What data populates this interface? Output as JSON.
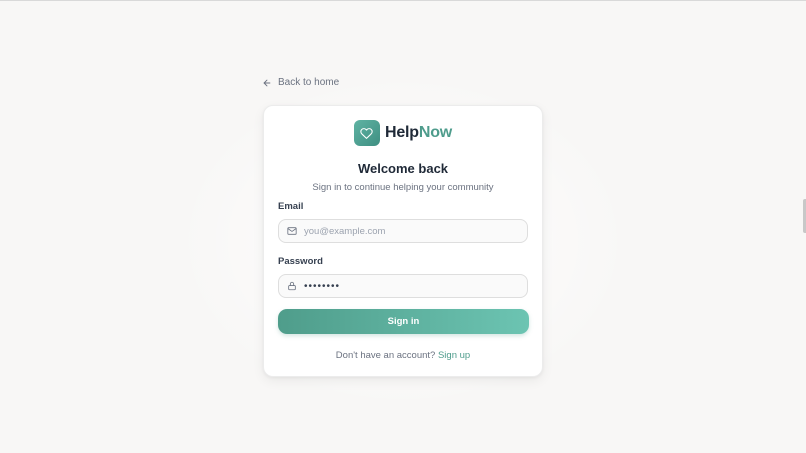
{
  "nav": {
    "back_label": "Back to home",
    "back_icon": "arrow-left-icon"
  },
  "brand": {
    "logo_icon": "heart-icon",
    "name_part1": "Help",
    "name_part2": "Now",
    "accent_color": "#4e9c8c"
  },
  "form": {
    "title": "Welcome back",
    "subtitle": "Sign in to continue helping your community",
    "email_label": "Email",
    "email_placeholder": "you@example.com",
    "email_icon": "mail-icon",
    "password_label": "Password",
    "password_value": "password",
    "password_icon": "lock-icon",
    "submit_label": "Sign in"
  },
  "footer": {
    "prompt": "Don't have an account?",
    "signup_label": "Sign up"
  }
}
